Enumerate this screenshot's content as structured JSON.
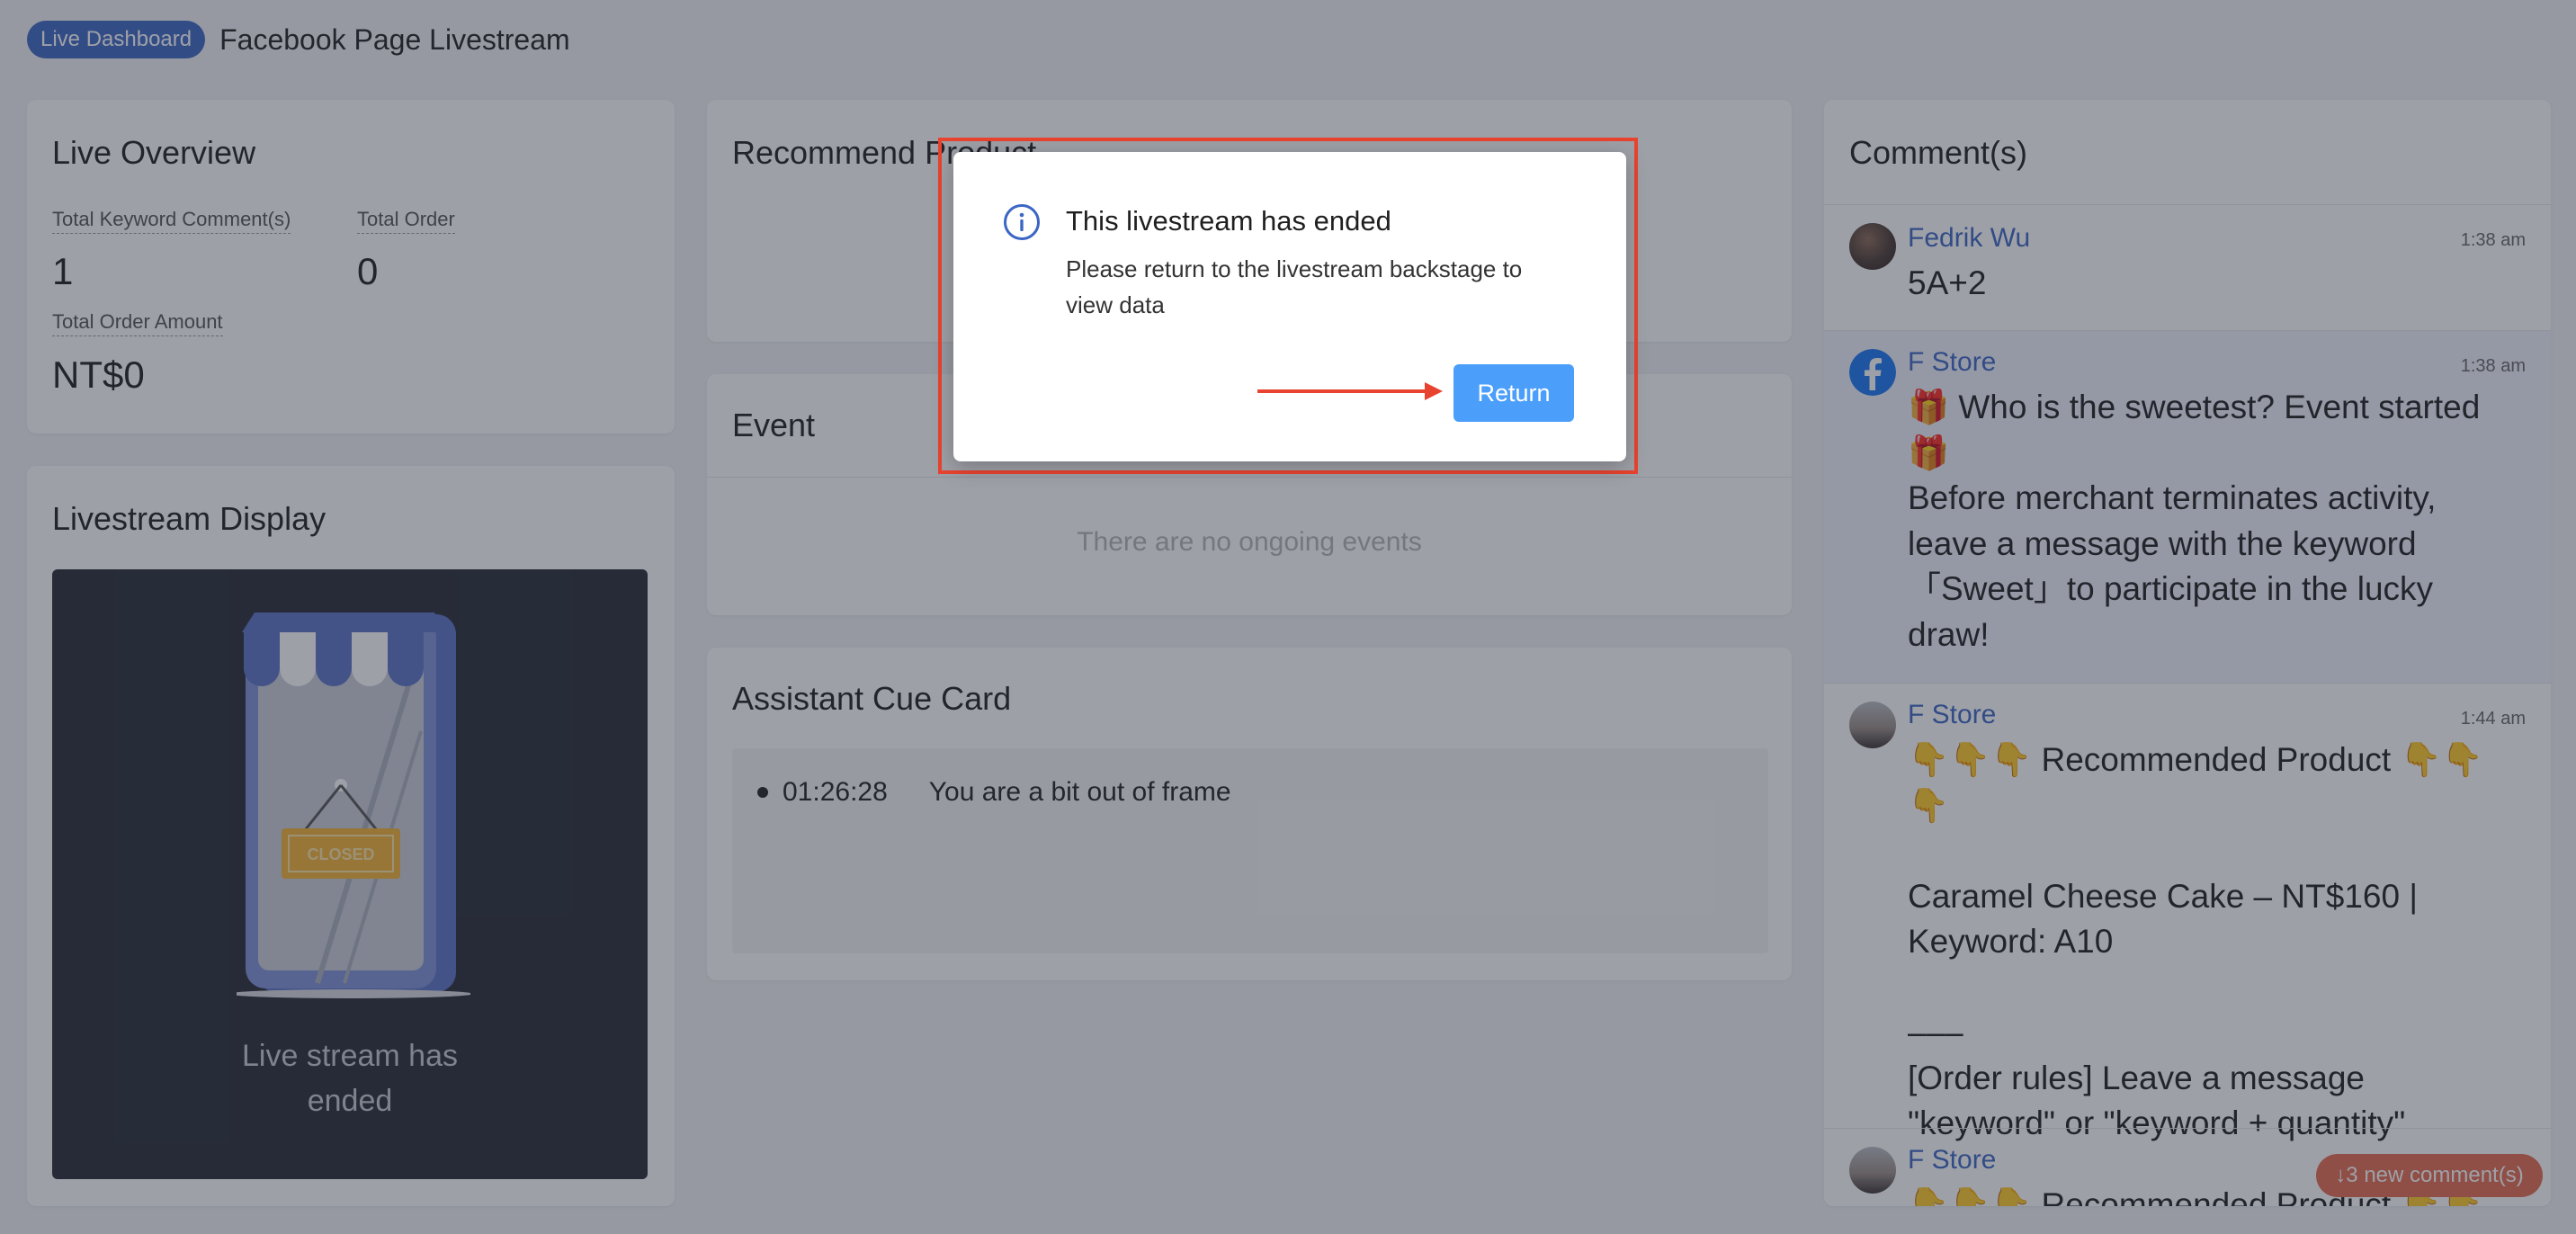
{
  "header": {
    "badge": "Live Dashboard",
    "title": "Facebook Page Livestream"
  },
  "overview": {
    "title": "Live Overview",
    "stats": [
      {
        "label": "Total Keyword Comment(s)",
        "value": "1"
      },
      {
        "label": "Total Order",
        "value": "0"
      },
      {
        "label": "Total Order Amount",
        "value": "NT$0"
      }
    ]
  },
  "display": {
    "title": "Livestream Display",
    "sign_text": "CLOSED",
    "ended_line1": "Live stream has",
    "ended_line2": "ended"
  },
  "recommend": {
    "title": "Recommend Product"
  },
  "event": {
    "title": "Event",
    "empty": "There are no ongoing events"
  },
  "cue": {
    "title": "Assistant Cue Card",
    "items": [
      {
        "time": "01:26:28",
        "text": "You are a bit out of frame"
      }
    ]
  },
  "comments": {
    "title": "Comment(s)",
    "items": [
      {
        "name": "Fedrik Wu",
        "time": "1:38 am",
        "text": "5A+2"
      },
      {
        "name": "F Store",
        "time": "1:38 am",
        "text": "🎁 Who is the sweetest? Event started\n🎁\nBefore merchant terminates activity, leave a message with the keyword 「Sweet」to participate in the lucky draw!"
      },
      {
        "name": "F Store",
        "time": "1:44 am",
        "text": "👇👇👇 Recommended Product 👇👇👇\n\nCaramel Cheese Cake – NT$160 | Keyword: A10\n\n–––\n[Order rules] Leave a message \"keyword\" or \"keyword + quantity\""
      },
      {
        "name": "F Store",
        "time": "",
        "text": "👇👇👇 Recommended Product 👇👇👇"
      }
    ],
    "new_pill": "↓3 new comment(s)"
  },
  "modal": {
    "title": "This livestream has ended",
    "body": "Please return to the livestream backstage to view data",
    "button": "Return"
  },
  "colors": {
    "accent": "#3b66c4",
    "button": "#4b9ef9",
    "annotation": "#e8432f",
    "new_pill": "#e36b4f"
  }
}
